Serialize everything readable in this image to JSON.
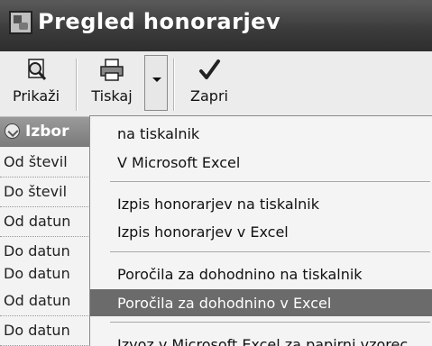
{
  "window": {
    "title": "Pregled honorarjev"
  },
  "toolbar": {
    "prikazi_label": "Prikaži",
    "tiskaj_label": "Tiskaj",
    "zapri_label": "Zapri"
  },
  "panel": {
    "header": "Izbor",
    "rows": [
      "Od števil",
      "Do števil",
      "Od datun",
      "Do datun",
      "Do datun",
      "Od datun",
      "Do datun"
    ]
  },
  "menu": {
    "items": [
      "na tiskalnik",
      "V Microsoft Excel",
      "Izpis honorarjev na tiskalnik",
      "Izpis honorarjev v Excel",
      "Poročila za dohodnino na tiskalnik",
      "Poročila za dohodnino v Excel",
      "Izvoz v Microsoft Excel za papirni vzorec"
    ],
    "selected_index": 5
  },
  "colors": {
    "titlebar": "#3a3a3a",
    "selection": "#6b6b6b"
  }
}
